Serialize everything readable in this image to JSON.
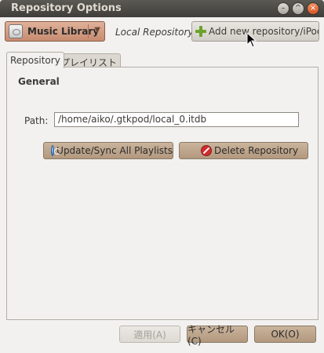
{
  "window": {
    "title": "Repository Options",
    "controls": [
      "minimize-icon",
      "maximize-icon",
      "close-icon"
    ]
  },
  "toolbar": {
    "repository_combo": {
      "label": "Music Library",
      "icon": "media-device-icon",
      "arrow_icon": "chevron-down-icon"
    },
    "repository_type": "Local Repository",
    "add_button": {
      "label": "Add new repository/iPod...",
      "icon": "plus-icon"
    }
  },
  "tabs": [
    {
      "label": "Repository",
      "active": true
    },
    {
      "label": "プレイリスト",
      "active": false
    }
  ],
  "general": {
    "title": "General",
    "path_label": "Path:",
    "path_value": "/home/aiko/.gtkpod/local_0.itdb",
    "sync_button": {
      "label": "Update/Sync All Playlists",
      "icon": "sync-icon"
    },
    "delete_button": {
      "label": "Delete Repository",
      "icon": "delete-icon"
    }
  },
  "buttons": {
    "apply": "適用(A)",
    "cancel": "キャンセル(C)",
    "ok": "OK(O)"
  },
  "colors": {
    "titlebar": "#3f3e3a",
    "accent_button": "#b2987e",
    "combo_accent": "#c68b70"
  }
}
